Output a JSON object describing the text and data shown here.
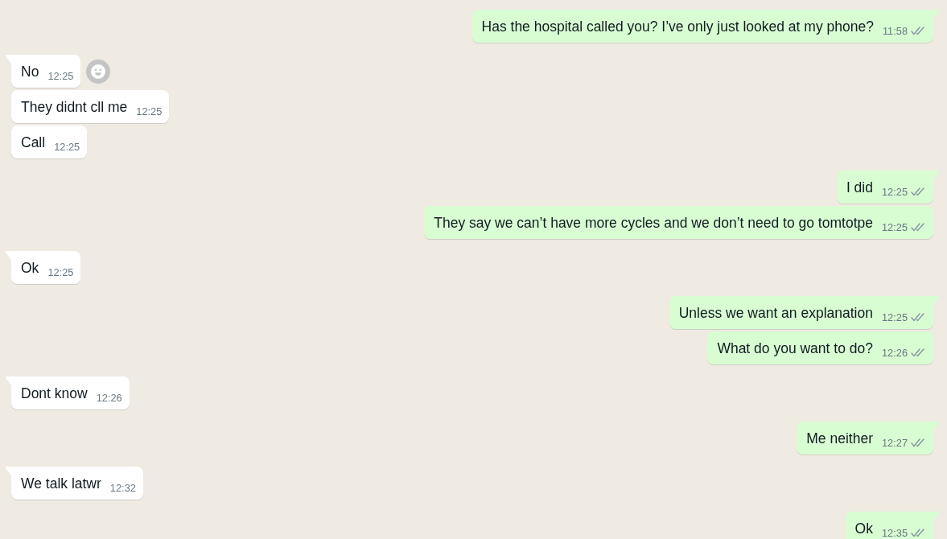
{
  "chat": {
    "messages": [
      {
        "kind": "outgoing",
        "text": "Has the hospital called you? I’ve only just looked at my phone?",
        "time": "11:58",
        "read": false,
        "tail": true,
        "reaction_button": false
      },
      {
        "kind": "incoming",
        "text": "No",
        "time": "12:25",
        "tail": true,
        "reaction_button": true
      },
      {
        "kind": "incoming",
        "text": "They didnt cll me",
        "time": "12:25",
        "tail": false,
        "reaction_button": false
      },
      {
        "kind": "incoming",
        "text": "Call",
        "time": "12:25",
        "tail": false,
        "reaction_button": false
      },
      {
        "kind": "outgoing",
        "text": "I did",
        "time": "12:25",
        "read": false,
        "tail": true,
        "reaction_button": false
      },
      {
        "kind": "outgoing",
        "text": "They say we can’t have more cycles and we don’t need to go tomtotpe",
        "time": "12:25",
        "read": false,
        "tail": false,
        "reaction_button": false
      },
      {
        "kind": "incoming",
        "text": "Ok",
        "time": "12:25",
        "tail": true,
        "reaction_button": false
      },
      {
        "kind": "outgoing",
        "text": "Unless we want an explanation",
        "time": "12:25",
        "read": false,
        "tail": true,
        "reaction_button": false
      },
      {
        "kind": "outgoing",
        "text": "What do you want to do?",
        "time": "12:26",
        "read": false,
        "tail": false,
        "reaction_button": false
      },
      {
        "kind": "incoming",
        "text": "Dont know",
        "time": "12:26",
        "tail": true,
        "reaction_button": false
      },
      {
        "kind": "outgoing",
        "text": "Me neither",
        "time": "12:27",
        "read": false,
        "tail": true,
        "reaction_button": false
      },
      {
        "kind": "incoming",
        "text": "We talk latwr",
        "time": "12:32",
        "tail": true,
        "reaction_button": false
      },
      {
        "kind": "outgoing",
        "text": "Ok",
        "time": "12:35",
        "read": false,
        "tail": true,
        "reaction_button": false
      }
    ]
  }
}
